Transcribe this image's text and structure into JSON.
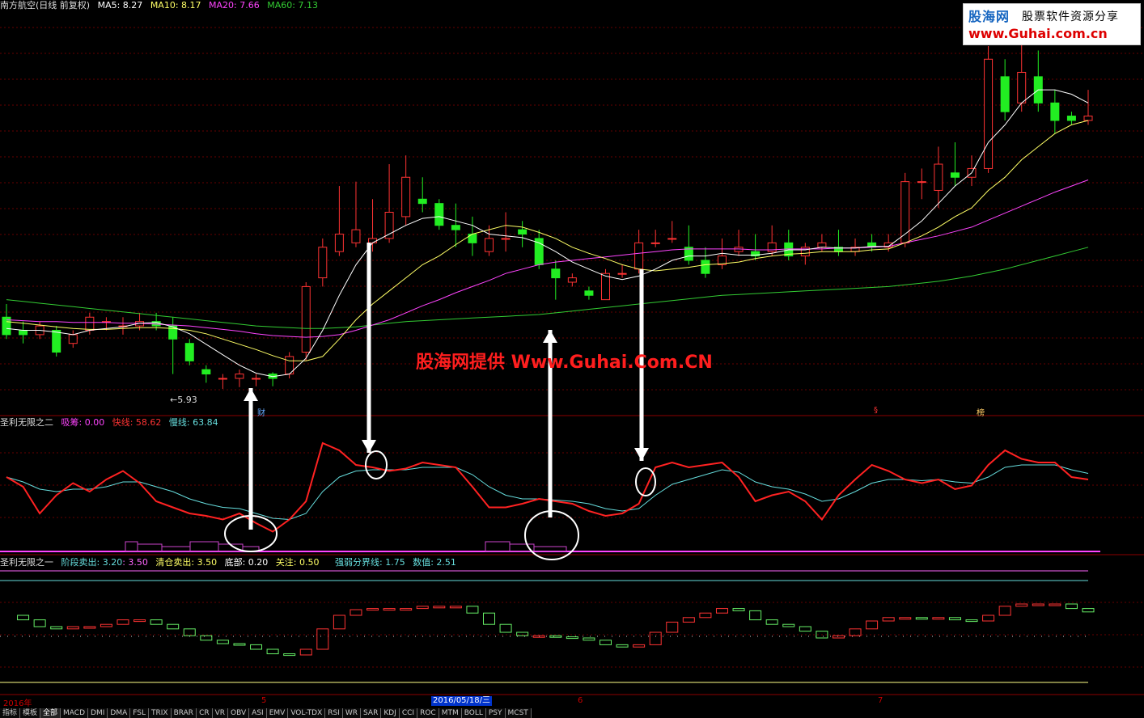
{
  "header": {
    "stock": "南方航空(日线 前复权)",
    "ma5": "MA5: 8.27",
    "ma10": "MA10: 8.17",
    "ma20": "MA20: 7.66",
    "ma60": "MA60: 7.13",
    "colors": {
      "ma5": "#ffffff",
      "ma10": "#ffff66",
      "ma20": "#ff44ff",
      "ma60": "#33cc33"
    }
  },
  "brand": {
    "name": "股海网",
    "slogan": "股票软件资源分享",
    "url": "www.Guhai.com.cn"
  },
  "watermark": "股海网提供 Www.Guhai.Com.CN",
  "price_panel": {
    "low_label": "←5.93"
  },
  "indicator1": {
    "name": "圣利无限之二",
    "suction": "吸筹: 0.00",
    "fast": "快线: 58.62",
    "slow": "慢线: 63.84",
    "colors": {
      "suction": "#ff44ff",
      "fast": "#ff2222",
      "slow": "#66dddd"
    }
  },
  "indicator2": {
    "name": "圣利无限之一",
    "stage_sell": "阶段卖出: 3.20",
    "stage_sell2": ": 3.50",
    "clear_sell": "清仓卖出: 3.50",
    "bottom": "底部: 0.20",
    "focus": "关注: 0.50",
    "strong_weak": "强弱分界线: 1.75",
    "value": "数值: 2.51"
  },
  "date_axis": {
    "year": "2016年",
    "months": [
      "5",
      "6",
      "7"
    ],
    "selected_date": "2016/05/18/三"
  },
  "markers": {
    "cai": "财",
    "dollar": "§",
    "bang": "榜"
  },
  "tabs": [
    "指标",
    "模板",
    "全部",
    "MACD",
    "DMI",
    "DMA",
    "FSL",
    "TRIX",
    "BRAR",
    "CR",
    "VR",
    "OBV",
    "ASI",
    "EMV",
    "VOL-TDX",
    "RSI",
    "WR",
    "SAR",
    "KDJ",
    "CCI",
    "ROC",
    "MTM",
    "BOLL",
    "PSY",
    "MCST"
  ],
  "active_tab": "全部",
  "chart_data": {
    "type": "candlestick",
    "title": "南方航空(日线 前复权)",
    "candles": [
      [
        6.75,
        6.55,
        6.9,
        6.5
      ],
      [
        6.6,
        6.55,
        6.7,
        6.45
      ],
      [
        6.55,
        6.65,
        6.7,
        6.5
      ],
      [
        6.6,
        6.35,
        6.65,
        6.3
      ],
      [
        6.45,
        6.55,
        6.6,
        6.4
      ],
      [
        6.6,
        6.75,
        6.8,
        6.55
      ],
      [
        6.7,
        6.7,
        6.75,
        6.6
      ],
      [
        6.65,
        6.65,
        6.75,
        6.55
      ],
      [
        6.65,
        6.7,
        6.8,
        6.6
      ],
      [
        6.7,
        6.65,
        6.8,
        6.6
      ],
      [
        6.65,
        6.5,
        6.75,
        6.1
      ],
      [
        6.45,
        6.25,
        6.5,
        6.2
      ],
      [
        6.15,
        6.1,
        6.2,
        6.0
      ],
      [
        6.05,
        6.05,
        6.1,
        5.93
      ],
      [
        6.05,
        6.1,
        6.15,
        5.95
      ],
      [
        6.05,
        6.05,
        6.1,
        5.96
      ],
      [
        6.1,
        6.05,
        6.12,
        5.96
      ],
      [
        6.1,
        6.3,
        6.35,
        6.05
      ],
      [
        6.35,
        7.1,
        7.15,
        6.25
      ],
      [
        7.2,
        7.55,
        7.65,
        7.1
      ],
      [
        7.5,
        7.7,
        8.25,
        7.45
      ],
      [
        7.6,
        7.75,
        8.3,
        7.55
      ],
      [
        7.6,
        7.65,
        8.1,
        7.5
      ],
      [
        7.65,
        7.95,
        8.5,
        7.6
      ],
      [
        7.9,
        8.35,
        8.6,
        7.8
      ],
      [
        8.1,
        8.05,
        8.35,
        7.95
      ],
      [
        8.05,
        7.8,
        8.1,
        7.75
      ],
      [
        7.8,
        7.75,
        8.05,
        7.55
      ],
      [
        7.7,
        7.6,
        7.9,
        7.45
      ],
      [
        7.5,
        7.65,
        7.8,
        7.45
      ],
      [
        7.65,
        7.65,
        7.95,
        7.5
      ],
      [
        7.75,
        7.7,
        7.85,
        7.55
      ],
      [
        7.65,
        7.35,
        7.75,
        7.3
      ],
      [
        7.3,
        7.2,
        7.4,
        6.95
      ],
      [
        7.15,
        7.2,
        7.25,
        7.1
      ],
      [
        7.05,
        7.0,
        7.1,
        6.95
      ],
      [
        6.95,
        7.25,
        7.3,
        6.95
      ],
      [
        7.25,
        7.25,
        7.35,
        7.2
      ],
      [
        7.3,
        7.6,
        7.75,
        7.25
      ],
      [
        7.6,
        7.6,
        7.75,
        7.55
      ],
      [
        7.65,
        7.65,
        7.85,
        7.6
      ],
      [
        7.55,
        7.4,
        7.8,
        7.35
      ],
      [
        7.4,
        7.25,
        7.55,
        7.2
      ],
      [
        7.35,
        7.45,
        7.65,
        7.3
      ],
      [
        7.5,
        7.55,
        7.75,
        7.45
      ],
      [
        7.5,
        7.45,
        7.7,
        7.4
      ],
      [
        7.5,
        7.6,
        7.8,
        7.45
      ],
      [
        7.6,
        7.45,
        7.75,
        7.4
      ],
      [
        7.45,
        7.55,
        7.6,
        7.35
      ],
      [
        7.55,
        7.6,
        7.7,
        7.5
      ],
      [
        7.55,
        7.5,
        7.75,
        7.45
      ],
      [
        7.5,
        7.55,
        7.65,
        7.45
      ],
      [
        7.6,
        7.55,
        7.7,
        7.5
      ],
      [
        7.55,
        7.6,
        7.7,
        7.5
      ],
      [
        7.6,
        8.3,
        8.4,
        7.55
      ],
      [
        8.3,
        8.3,
        8.45,
        8.1
      ],
      [
        8.2,
        8.5,
        8.7,
        8.0
      ],
      [
        8.4,
        8.35,
        8.75,
        8.25
      ],
      [
        8.35,
        8.45,
        8.6,
        8.25
      ],
      [
        8.45,
        9.7,
        9.85,
        8.4
      ],
      [
        9.5,
        9.1,
        9.7,
        9.0
      ],
      [
        9.2,
        9.55,
        9.9,
        9.1
      ],
      [
        9.5,
        9.2,
        9.8,
        9.1
      ],
      [
        9.2,
        9.0,
        9.35,
        8.85
      ],
      [
        9.05,
        9.0,
        9.1,
        8.95
      ],
      [
        9.0,
        9.05,
        9.35,
        8.95
      ]
    ],
    "ma5": [
      6.62,
      6.6,
      6.6,
      6.58,
      6.55,
      6.6,
      6.62,
      6.64,
      6.68,
      6.69,
      6.64,
      6.56,
      6.44,
      6.32,
      6.2,
      6.11,
      6.07,
      6.1,
      6.28,
      6.6,
      7.0,
      7.35,
      7.6,
      7.7,
      7.8,
      7.88,
      7.9,
      7.85,
      7.8,
      7.7,
      7.68,
      7.66,
      7.6,
      7.5,
      7.38,
      7.3,
      7.22,
      7.18,
      7.22,
      7.3,
      7.4,
      7.45,
      7.45,
      7.48,
      7.46,
      7.46,
      7.48,
      7.52,
      7.52,
      7.55,
      7.54,
      7.54,
      7.56,
      7.56,
      7.7,
      7.85,
      8.05,
      8.25,
      8.4,
      8.75,
      8.95,
      9.2,
      9.35,
      9.35,
      9.3,
      9.2
    ],
    "ma10": [
      6.7,
      6.68,
      6.66,
      6.64,
      6.62,
      6.61,
      6.61,
      6.62,
      6.63,
      6.63,
      6.62,
      6.6,
      6.56,
      6.5,
      6.44,
      6.38,
      6.31,
      6.25,
      6.25,
      6.3,
      6.5,
      6.72,
      6.9,
      7.05,
      7.2,
      7.35,
      7.45,
      7.58,
      7.7,
      7.75,
      7.8,
      7.78,
      7.72,
      7.65,
      7.55,
      7.48,
      7.42,
      7.35,
      7.3,
      7.28,
      7.3,
      7.32,
      7.35,
      7.36,
      7.38,
      7.42,
      7.45,
      7.47,
      7.48,
      7.5,
      7.5,
      7.5,
      7.52,
      7.53,
      7.6,
      7.68,
      7.78,
      7.9,
      8.0,
      8.2,
      8.35,
      8.55,
      8.7,
      8.85,
      8.95,
      9.0
    ],
    "ma20": [
      6.72,
      6.71,
      6.7,
      6.7,
      6.69,
      6.69,
      6.69,
      6.68,
      6.68,
      6.67,
      6.66,
      6.65,
      6.63,
      6.61,
      6.59,
      6.56,
      6.54,
      6.53,
      6.52,
      6.53,
      6.55,
      6.6,
      6.66,
      6.72,
      6.8,
      6.88,
      6.95,
      7.03,
      7.1,
      7.17,
      7.25,
      7.3,
      7.35,
      7.38,
      7.4,
      7.42,
      7.44,
      7.46,
      7.48,
      7.5,
      7.52,
      7.53,
      7.53,
      7.53,
      7.53,
      7.52,
      7.52,
      7.53,
      7.53,
      7.53,
      7.54,
      7.54,
      7.55,
      7.56,
      7.6,
      7.64,
      7.68,
      7.73,
      7.78,
      7.86,
      7.94,
      8.02,
      8.1,
      8.18,
      8.25,
      8.32
    ],
    "ma60": [
      6.95,
      6.93,
      6.91,
      6.89,
      6.87,
      6.85,
      6.83,
      6.81,
      6.79,
      6.77,
      6.75,
      6.73,
      6.71,
      6.69,
      6.67,
      6.65,
      6.64,
      6.63,
      6.62,
      6.62,
      6.63,
      6.64,
      6.66,
      6.68,
      6.7,
      6.71,
      6.72,
      6.73,
      6.74,
      6.75,
      6.76,
      6.77,
      6.78,
      6.8,
      6.82,
      6.84,
      6.86,
      6.88,
      6.9,
      6.92,
      6.94,
      6.96,
      6.98,
      7.0,
      7.01,
      7.02,
      7.03,
      7.04,
      7.05,
      7.06,
      7.07,
      7.08,
      7.09,
      7.1,
      7.12,
      7.14,
      7.16,
      7.19,
      7.22,
      7.26,
      7.3,
      7.35,
      7.4,
      7.45,
      7.5,
      7.55
    ],
    "fast": [
      60,
      52,
      30,
      45,
      55,
      48,
      58,
      65,
      55,
      40,
      35,
      30,
      28,
      25,
      30,
      22,
      15,
      25,
      40,
      88,
      82,
      70,
      68,
      65,
      67,
      72,
      70,
      68,
      52,
      35,
      35,
      38,
      42,
      40,
      38,
      32,
      28,
      30,
      38,
      68,
      72,
      68,
      70,
      72,
      60,
      40,
      45,
      48,
      40,
      25,
      45,
      58,
      70,
      65,
      58,
      55,
      58,
      50,
      53,
      70,
      82,
      75,
      72,
      72,
      60,
      58
    ],
    "slow": [
      60,
      56,
      50,
      48,
      50,
      50,
      52,
      56,
      56,
      52,
      48,
      42,
      38,
      35,
      34,
      30,
      26,
      25,
      30,
      48,
      60,
      65,
      66,
      66,
      66,
      68,
      68,
      68,
      62,
      52,
      45,
      42,
      42,
      41,
      40,
      38,
      34,
      32,
      34,
      45,
      54,
      58,
      62,
      66,
      64,
      56,
      52,
      50,
      46,
      40,
      42,
      48,
      55,
      58,
      58,
      57,
      58,
      56,
      55,
      60,
      68,
      70,
      70,
      70,
      66,
      63
    ]
  }
}
